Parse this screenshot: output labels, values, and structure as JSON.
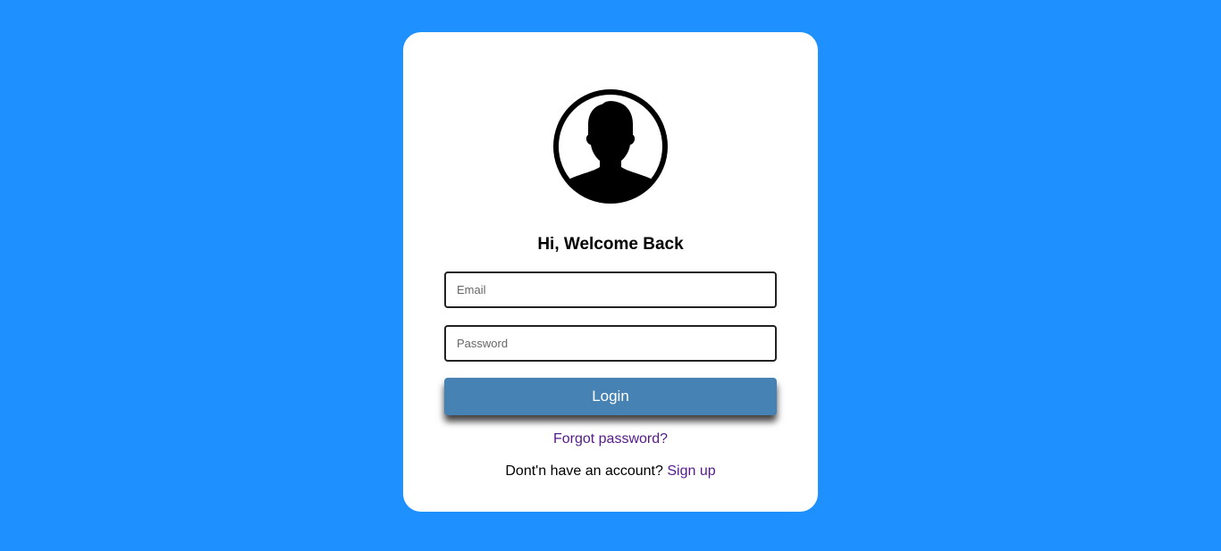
{
  "colors": {
    "background": "#1e90ff",
    "card": "#ffffff",
    "button": "#4682b4",
    "link": "#551a8b"
  },
  "avatar": {
    "icon": "user-profile-icon"
  },
  "card": {
    "title": "Hi, Welcome Back"
  },
  "form": {
    "email_placeholder": "Email",
    "email_value": "",
    "password_placeholder": "Password",
    "password_value": "",
    "login_label": "Login"
  },
  "links": {
    "forgot_password": "Forgot password?",
    "no_account_text": "Dont'n have an account?",
    "signup": "Sign up"
  }
}
